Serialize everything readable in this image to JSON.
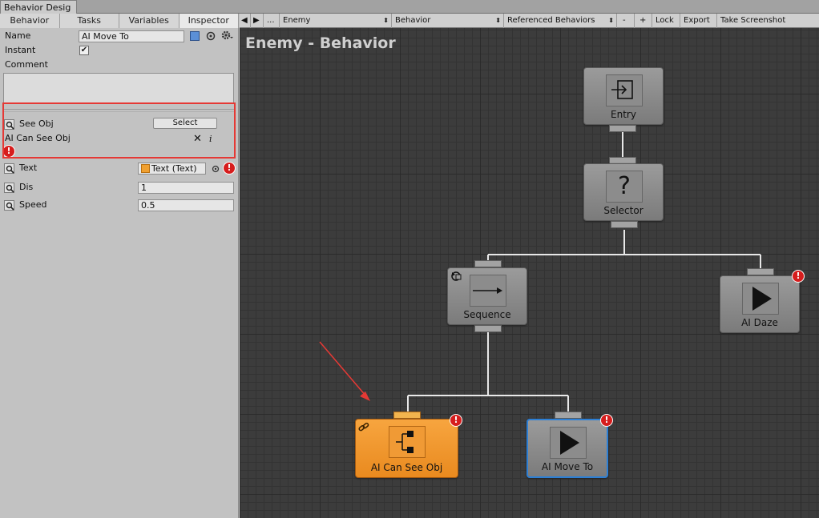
{
  "window": {
    "tab_title": "Behavior Desig"
  },
  "left_tabs": [
    "Behavior",
    "Tasks",
    "Variables",
    "Inspector"
  ],
  "inspector": {
    "name_label": "Name",
    "name_value": "AI   Move To",
    "instant_label": "Instant",
    "instant_checked": "✔",
    "comment_label": "Comment",
    "see_obj_label": "See Obj",
    "select_button": "Select",
    "linked_task": "AI    Can See Obj",
    "remove_glyph": "✕",
    "info_glyph": "i",
    "text_label": "Text",
    "text_value": "Text (Text)",
    "dis_label": "Dis",
    "dis_value": "1",
    "speed_label": "Speed",
    "speed_value": "0.5",
    "error_glyph": "!"
  },
  "toolbar": {
    "back": "◀",
    "forward": "▶",
    "more": "...",
    "object": "Enemy",
    "behavior": "Behavior",
    "referenced": "Referenced Behaviors",
    "minus": "-",
    "plus": "+",
    "lock": "Lock",
    "export": "Export",
    "screenshot": "Take Screenshot",
    "dropdown_glyph": "⬍"
  },
  "graph": {
    "title": "Enemy - Behavior",
    "nodes": {
      "entry": "Entry",
      "selector": "Selector",
      "sequence": "Sequence",
      "daze": "AI    Daze",
      "can_see": "AI    Can See Obj",
      "move_to": "AI    Move To"
    },
    "selector_glyph": "?"
  },
  "colors": {
    "error": "#d61d1d",
    "highlight_box": "#e53935",
    "selected_node": "#f09a35",
    "active_border": "#2d7fd4"
  }
}
